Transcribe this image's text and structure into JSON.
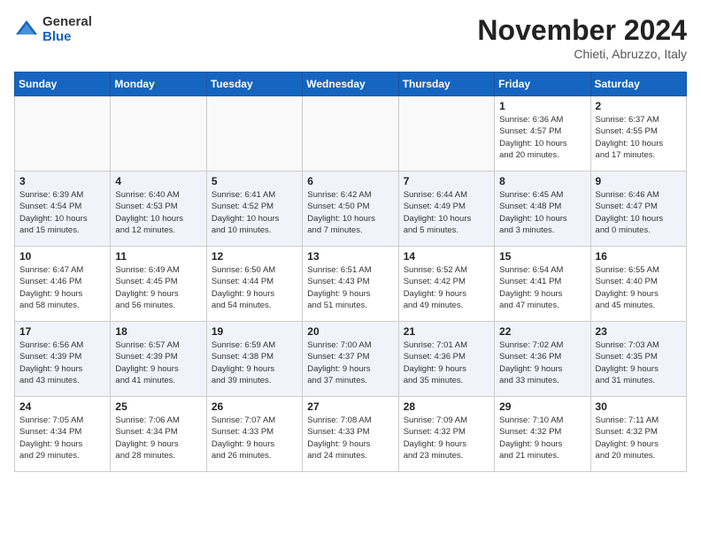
{
  "header": {
    "logo_general": "General",
    "logo_blue": "Blue",
    "month_title": "November 2024",
    "location": "Chieti, Abruzzo, Italy"
  },
  "weekdays": [
    "Sunday",
    "Monday",
    "Tuesday",
    "Wednesday",
    "Thursday",
    "Friday",
    "Saturday"
  ],
  "weeks": [
    [
      {
        "day": "",
        "info": ""
      },
      {
        "day": "",
        "info": ""
      },
      {
        "day": "",
        "info": ""
      },
      {
        "day": "",
        "info": ""
      },
      {
        "day": "",
        "info": ""
      },
      {
        "day": "1",
        "info": "Sunrise: 6:36 AM\nSunset: 4:57 PM\nDaylight: 10 hours\nand 20 minutes."
      },
      {
        "day": "2",
        "info": "Sunrise: 6:37 AM\nSunset: 4:55 PM\nDaylight: 10 hours\nand 17 minutes."
      }
    ],
    [
      {
        "day": "3",
        "info": "Sunrise: 6:39 AM\nSunset: 4:54 PM\nDaylight: 10 hours\nand 15 minutes."
      },
      {
        "day": "4",
        "info": "Sunrise: 6:40 AM\nSunset: 4:53 PM\nDaylight: 10 hours\nand 12 minutes."
      },
      {
        "day": "5",
        "info": "Sunrise: 6:41 AM\nSunset: 4:52 PM\nDaylight: 10 hours\nand 10 minutes."
      },
      {
        "day": "6",
        "info": "Sunrise: 6:42 AM\nSunset: 4:50 PM\nDaylight: 10 hours\nand 7 minutes."
      },
      {
        "day": "7",
        "info": "Sunrise: 6:44 AM\nSunset: 4:49 PM\nDaylight: 10 hours\nand 5 minutes."
      },
      {
        "day": "8",
        "info": "Sunrise: 6:45 AM\nSunset: 4:48 PM\nDaylight: 10 hours\nand 3 minutes."
      },
      {
        "day": "9",
        "info": "Sunrise: 6:46 AM\nSunset: 4:47 PM\nDaylight: 10 hours\nand 0 minutes."
      }
    ],
    [
      {
        "day": "10",
        "info": "Sunrise: 6:47 AM\nSunset: 4:46 PM\nDaylight: 9 hours\nand 58 minutes."
      },
      {
        "day": "11",
        "info": "Sunrise: 6:49 AM\nSunset: 4:45 PM\nDaylight: 9 hours\nand 56 minutes."
      },
      {
        "day": "12",
        "info": "Sunrise: 6:50 AM\nSunset: 4:44 PM\nDaylight: 9 hours\nand 54 minutes."
      },
      {
        "day": "13",
        "info": "Sunrise: 6:51 AM\nSunset: 4:43 PM\nDaylight: 9 hours\nand 51 minutes."
      },
      {
        "day": "14",
        "info": "Sunrise: 6:52 AM\nSunset: 4:42 PM\nDaylight: 9 hours\nand 49 minutes."
      },
      {
        "day": "15",
        "info": "Sunrise: 6:54 AM\nSunset: 4:41 PM\nDaylight: 9 hours\nand 47 minutes."
      },
      {
        "day": "16",
        "info": "Sunrise: 6:55 AM\nSunset: 4:40 PM\nDaylight: 9 hours\nand 45 minutes."
      }
    ],
    [
      {
        "day": "17",
        "info": "Sunrise: 6:56 AM\nSunset: 4:39 PM\nDaylight: 9 hours\nand 43 minutes."
      },
      {
        "day": "18",
        "info": "Sunrise: 6:57 AM\nSunset: 4:39 PM\nDaylight: 9 hours\nand 41 minutes."
      },
      {
        "day": "19",
        "info": "Sunrise: 6:59 AM\nSunset: 4:38 PM\nDaylight: 9 hours\nand 39 minutes."
      },
      {
        "day": "20",
        "info": "Sunrise: 7:00 AM\nSunset: 4:37 PM\nDaylight: 9 hours\nand 37 minutes."
      },
      {
        "day": "21",
        "info": "Sunrise: 7:01 AM\nSunset: 4:36 PM\nDaylight: 9 hours\nand 35 minutes."
      },
      {
        "day": "22",
        "info": "Sunrise: 7:02 AM\nSunset: 4:36 PM\nDaylight: 9 hours\nand 33 minutes."
      },
      {
        "day": "23",
        "info": "Sunrise: 7:03 AM\nSunset: 4:35 PM\nDaylight: 9 hours\nand 31 minutes."
      }
    ],
    [
      {
        "day": "24",
        "info": "Sunrise: 7:05 AM\nSunset: 4:34 PM\nDaylight: 9 hours\nand 29 minutes."
      },
      {
        "day": "25",
        "info": "Sunrise: 7:06 AM\nSunset: 4:34 PM\nDaylight: 9 hours\nand 28 minutes."
      },
      {
        "day": "26",
        "info": "Sunrise: 7:07 AM\nSunset: 4:33 PM\nDaylight: 9 hours\nand 26 minutes."
      },
      {
        "day": "27",
        "info": "Sunrise: 7:08 AM\nSunset: 4:33 PM\nDaylight: 9 hours\nand 24 minutes."
      },
      {
        "day": "28",
        "info": "Sunrise: 7:09 AM\nSunset: 4:32 PM\nDaylight: 9 hours\nand 23 minutes."
      },
      {
        "day": "29",
        "info": "Sunrise: 7:10 AM\nSunset: 4:32 PM\nDaylight: 9 hours\nand 21 minutes."
      },
      {
        "day": "30",
        "info": "Sunrise: 7:11 AM\nSunset: 4:32 PM\nDaylight: 9 hours\nand 20 minutes."
      }
    ]
  ]
}
